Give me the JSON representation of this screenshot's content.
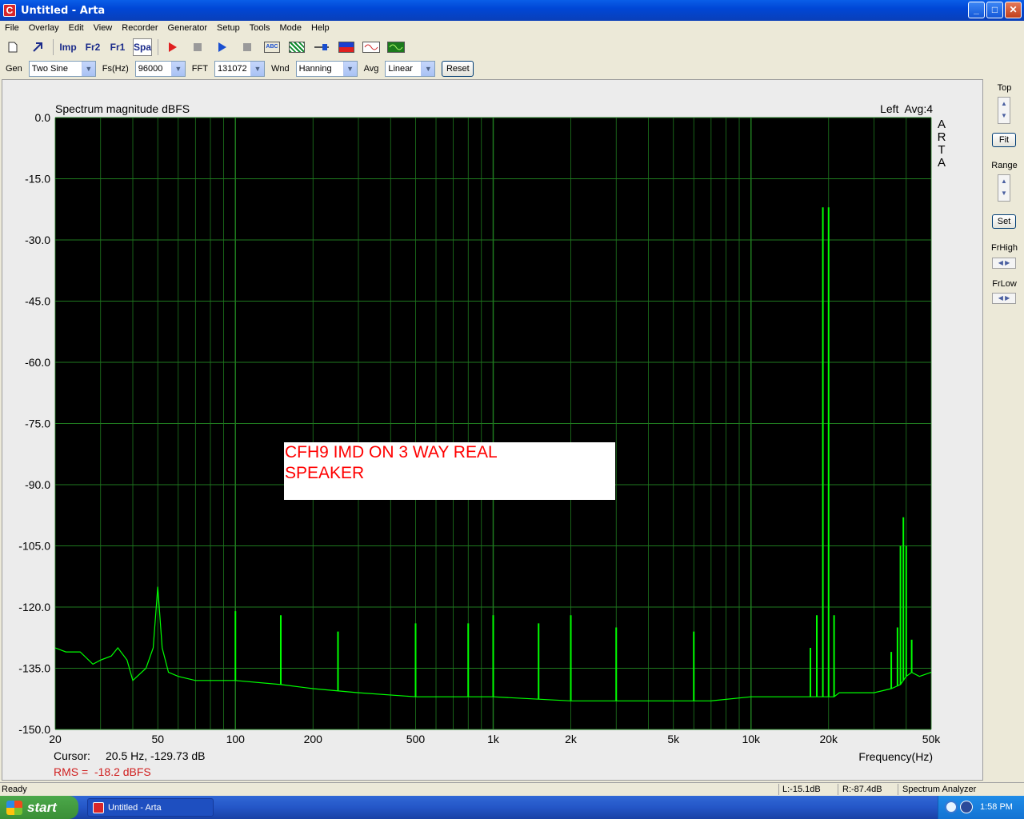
{
  "window": {
    "title": "Untitled - Arta",
    "app_icon": "C",
    "minimize": "_",
    "maximize": "□",
    "close": "✕"
  },
  "menu": [
    "File",
    "Overlay",
    "Edit",
    "View",
    "Recorder",
    "Generator",
    "Setup",
    "Tools",
    "Mode",
    "Help"
  ],
  "toolbar": {
    "imp": "Imp",
    "fr2": "Fr2",
    "fr1": "Fr1",
    "spa": "Spa",
    "abc": "ABC"
  },
  "params": {
    "gen_label": "Gen",
    "gen_value": "Two Sine",
    "fs_label": "Fs(Hz)",
    "fs_value": "96000",
    "fft_label": "FFT",
    "fft_value": "131072",
    "wnd_label": "Wnd",
    "wnd_value": "Hanning",
    "avg_label": "Avg",
    "avg_value": "Linear",
    "reset_label": "Reset"
  },
  "plot": {
    "note_line1": "CFH9 IMD ON 3 WAY REAL",
    "note_line2": "SPEAKER",
    "cursor_label": "Cursor:",
    "cursor_value": "20.5 Hz, -129.73 dB",
    "rms_text": "RMS =  -18.2 dBFS"
  },
  "side": {
    "top": "Top",
    "fit": "Fit",
    "range": "Range",
    "set": "Set",
    "frhigh": "FrHigh",
    "frlow": "FrLow"
  },
  "status": {
    "ready": "Ready",
    "left": "L:-15.1dB",
    "right": "R:-87.4dB",
    "mode": "Spectrum Analyzer"
  },
  "taskbar": {
    "start": "start",
    "item": "Untitled - Arta",
    "time": "1:58 PM"
  },
  "colors": {
    "trace": "#00ff00",
    "grid": "#1f7a1f",
    "plot_bg": "#000000",
    "note_text": "#ff0000"
  },
  "chart_data": {
    "type": "line",
    "title": "Spectrum magnitude dBFS",
    "legend": "Left  Avg:4",
    "watermark": "ARTA",
    "xlabel": "Frequency(Hz)",
    "x_scale": "log",
    "xlim": [
      20,
      50000
    ],
    "ylim": [
      -150,
      0
    ],
    "grid": true,
    "x_ticks": [
      20,
      50,
      100,
      200,
      500,
      1000,
      2000,
      5000,
      10000,
      20000,
      50000
    ],
    "x_tick_labels": [
      "20",
      "50",
      "100",
      "200",
      "500",
      "1k",
      "2k",
      "5k",
      "10k",
      "20k",
      "50k"
    ],
    "y_ticks": [
      0,
      -15,
      -30,
      -45,
      -60,
      -75,
      -90,
      -105,
      -120,
      -135,
      -150
    ],
    "y_tick_labels": [
      "0.0",
      "-15.0",
      "-30.0",
      "-45.0",
      "-60.0",
      "-75.0",
      "-90.0",
      "-105.0",
      "-120.0",
      "-135.0",
      "-150.0"
    ],
    "series": [
      {
        "x": [
          20,
          22,
          25,
          28,
          30,
          33,
          35,
          38,
          40,
          45,
          48,
          50,
          52,
          55,
          60,
          70,
          80,
          100,
          150,
          200,
          300,
          500,
          700,
          1000,
          2000,
          3000,
          5000,
          7000,
          10000,
          15000,
          18000,
          19000,
          20000,
          21000,
          22000,
          25000,
          30000,
          35000,
          38000,
          40000,
          42000,
          45000,
          50000
        ],
        "values": [
          -130,
          -131,
          -131,
          -134,
          -133,
          -132,
          -130,
          -133,
          -138,
          -135,
          -130,
          -115,
          -130,
          -136,
          -137,
          -138,
          -138,
          -138,
          -139,
          -140,
          -141,
          -142,
          -142,
          -142,
          -143,
          -143,
          -143,
          -143,
          -142,
          -142,
          -142,
          -142,
          -142,
          -142,
          -141,
          -141,
          -141,
          -140,
          -139,
          -137,
          -136,
          -137,
          -136
        ]
      }
    ],
    "peaks": [
      {
        "x": 50,
        "y": -115
      },
      {
        "x": 100,
        "y": -121
      },
      {
        "x": 150,
        "y": -122
      },
      {
        "x": 250,
        "y": -126
      },
      {
        "x": 500,
        "y": -124
      },
      {
        "x": 800,
        "y": -124
      },
      {
        "x": 1000,
        "y": -122
      },
      {
        "x": 1500,
        "y": -124
      },
      {
        "x": 2000,
        "y": -122
      },
      {
        "x": 3000,
        "y": -125
      },
      {
        "x": 6000,
        "y": -126
      },
      {
        "x": 17000,
        "y": -130
      },
      {
        "x": 18000,
        "y": -122
      },
      {
        "x": 19000,
        "y": -22
      },
      {
        "x": 20000,
        "y": -22
      },
      {
        "x": 21000,
        "y": -122
      },
      {
        "x": 35000,
        "y": -131
      },
      {
        "x": 37000,
        "y": -125
      },
      {
        "x": 38000,
        "y": -105
      },
      {
        "x": 39000,
        "y": -98
      },
      {
        "x": 40000,
        "y": -105
      },
      {
        "x": 42000,
        "y": -128
      }
    ]
  }
}
